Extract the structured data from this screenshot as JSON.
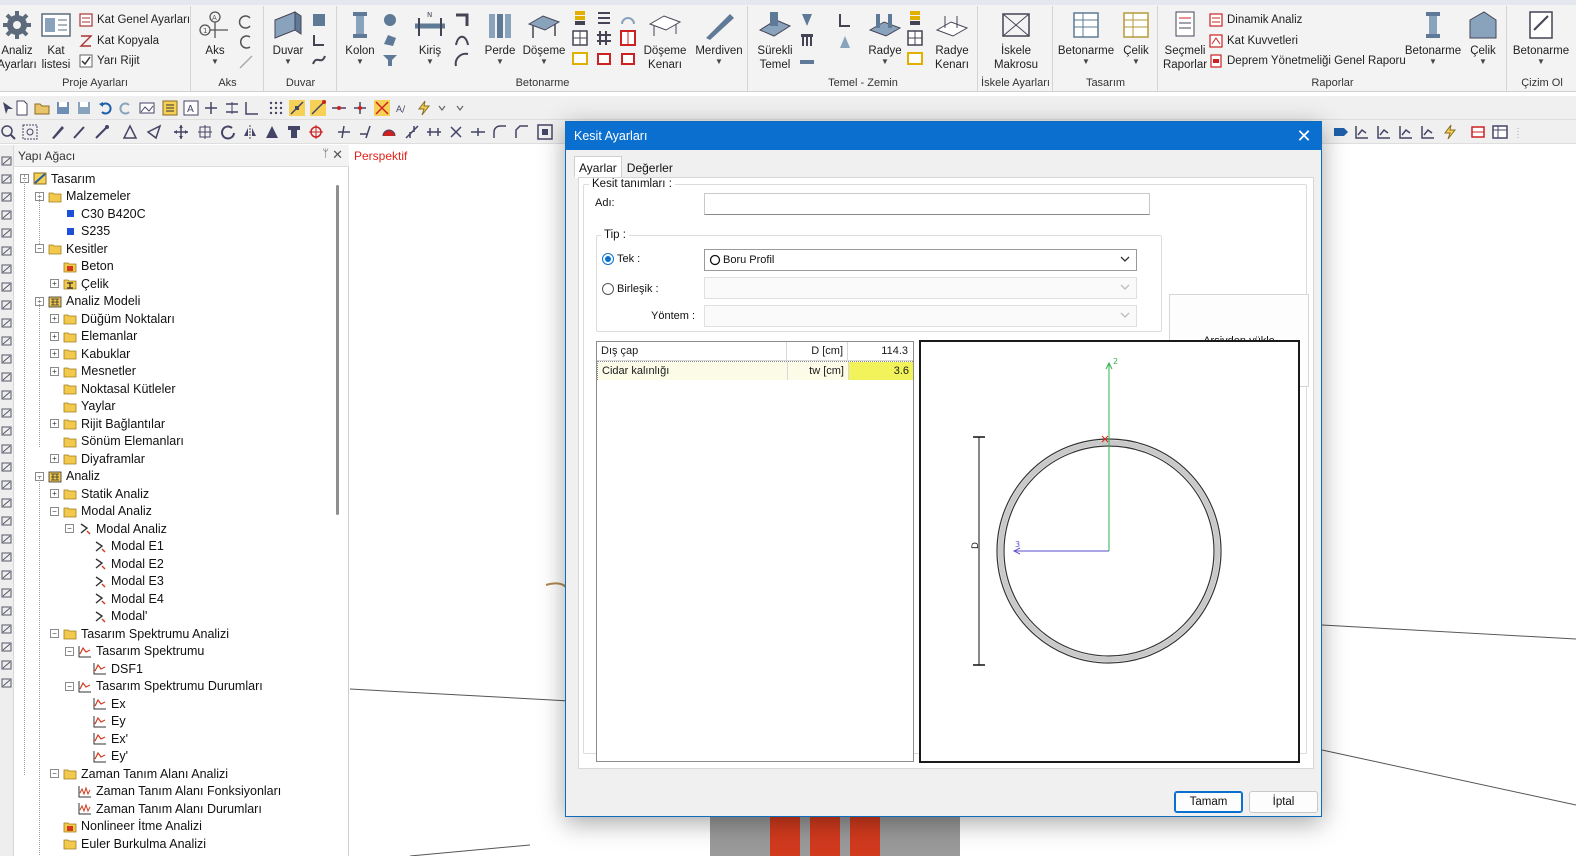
{
  "ribbon": {
    "groups": [
      {
        "label": "Proje Ayarları"
      },
      {
        "label": "Aks"
      },
      {
        "label": "Duvar"
      },
      {
        "label": "Betonarme"
      },
      {
        "label": "Temel - Zemin"
      },
      {
        "label": "İskele Ayarları"
      },
      {
        "label": "Tasarım"
      },
      {
        "label": "Raporlar"
      },
      {
        "label": "Çizim Ol"
      }
    ],
    "buttons": {
      "analiz_ayarlari": [
        "Analiz",
        "Ayarları"
      ],
      "kat_listesi": [
        "Kat",
        "listesi"
      ],
      "kat_genel_ayarlari": "Kat Genel Ayarları",
      "kat_kopyala": "Kat Kopyala",
      "yari_rijit": "Yarı Rijit",
      "aks": "Aks",
      "duvar": "Duvar",
      "kolon": "Kolon",
      "kiris": "Kiriş",
      "perde": "Perde",
      "doseme": "Döşeme",
      "doseme_kenari": [
        "Döşeme",
        "Kenarı"
      ],
      "merdiven": "Merdiven",
      "surekli_temel": [
        "Sürekli",
        "Temel"
      ],
      "radye": "Radye",
      "radye_kenari": [
        "Radye",
        "Kenarı"
      ],
      "iskele_makrosu": [
        "İskele",
        "Makrosu"
      ],
      "betonarme": "Betonarme",
      "celik": "Çelik",
      "secmeli_raporlar": [
        "Seçmeli",
        "Raporlar"
      ],
      "dinamik_analiz": "Dinamik Analiz",
      "kat_kuvvetleri": "Kat Kuvvetleri",
      "deprem_raporu": "Deprem Yönetmeliği Genel Raporu",
      "betonarme2": "Betonarme",
      "celik2": "Çelik",
      "betonarme3": "Betonarme"
    }
  },
  "tree": {
    "title": "Yapı Ağacı",
    "pin": "ᛘ",
    "close": "✕",
    "nodes": [
      {
        "label": "Tasarım"
      },
      {
        "label": "Malzemeler"
      },
      {
        "label": "C30 B420C"
      },
      {
        "label": "S235"
      },
      {
        "label": "Kesitler"
      },
      {
        "label": "Beton"
      },
      {
        "label": "Çelik"
      },
      {
        "label": "Analiz Modeli"
      },
      {
        "label": "Düğüm Noktaları"
      },
      {
        "label": "Elemanlar"
      },
      {
        "label": "Kabuklar"
      },
      {
        "label": "Mesnetler"
      },
      {
        "label": "Noktasal Kütleler"
      },
      {
        "label": "Yaylar"
      },
      {
        "label": "Rijit Bağlantılar"
      },
      {
        "label": "Sönüm Elemanları"
      },
      {
        "label": "Diyaframlar"
      },
      {
        "label": "Analiz"
      },
      {
        "label": "Statik Analiz"
      },
      {
        "label": "Modal Analiz"
      },
      {
        "label": "Modal Analiz"
      },
      {
        "label": "Modal E1"
      },
      {
        "label": "Modal E2"
      },
      {
        "label": "Modal E3"
      },
      {
        "label": "Modal E4"
      },
      {
        "label": "Modal'"
      },
      {
        "label": "Tasarım Spektrumu Analizi"
      },
      {
        "label": "Tasarım Spektrumu"
      },
      {
        "label": "DSF1"
      },
      {
        "label": "Tasarım Spektrumu Durumları"
      },
      {
        "label": "Ex"
      },
      {
        "label": "Ey"
      },
      {
        "label": "Ex'"
      },
      {
        "label": "Ey'"
      },
      {
        "label": "Zaman Tanım Alanı Analizi"
      },
      {
        "label": "Zaman Tanım Alanı Fonksiyonları"
      },
      {
        "label": "Zaman Tanım Alanı Durumları"
      },
      {
        "label": "Nonlineer İtme Analizi"
      },
      {
        "label": "Euler Burkulma Analizi"
      }
    ]
  },
  "viewport": {
    "label": "Perspektif"
  },
  "dialog": {
    "title": "Kesit Ayarları",
    "close": "✕",
    "tabs": [
      {
        "label": "Ayarlar",
        "active": true
      },
      {
        "label": "Değerler",
        "active": false
      }
    ],
    "kesit_tanimlari_legend": "Kesit tanımları :",
    "adi_label": "Adı:",
    "adi_value": "",
    "tip_legend": "Tip :",
    "tek_label": "Tek :",
    "tek_value": "Boru Profil",
    "birlesik_label": "Birleşik :",
    "birlesik_value": "",
    "yontem_label": "Yöntem :",
    "yontem_value": "",
    "arsiv_button": "Arşivden yükle",
    "params": [
      {
        "name": "Dış çap",
        "unit": "D [cm]",
        "value": "114.3",
        "selected": false
      },
      {
        "name": "Cidar kalınlığı",
        "unit": "tw [cm]",
        "value": "3.6",
        "selected": true
      }
    ],
    "preview": {
      "axis_z_label": "2",
      "axis_y_label": "3",
      "dim_label": "D"
    },
    "ok_button": "Tamam",
    "cancel_button": "İptal"
  },
  "colors": {
    "dialog_title_bar": "#0b6fd0",
    "selected_value_cell": "#f2f25a",
    "viewport_label": "#e0241b",
    "axis_z": "#2fb34a",
    "axis_y": "#5a4fc9"
  }
}
